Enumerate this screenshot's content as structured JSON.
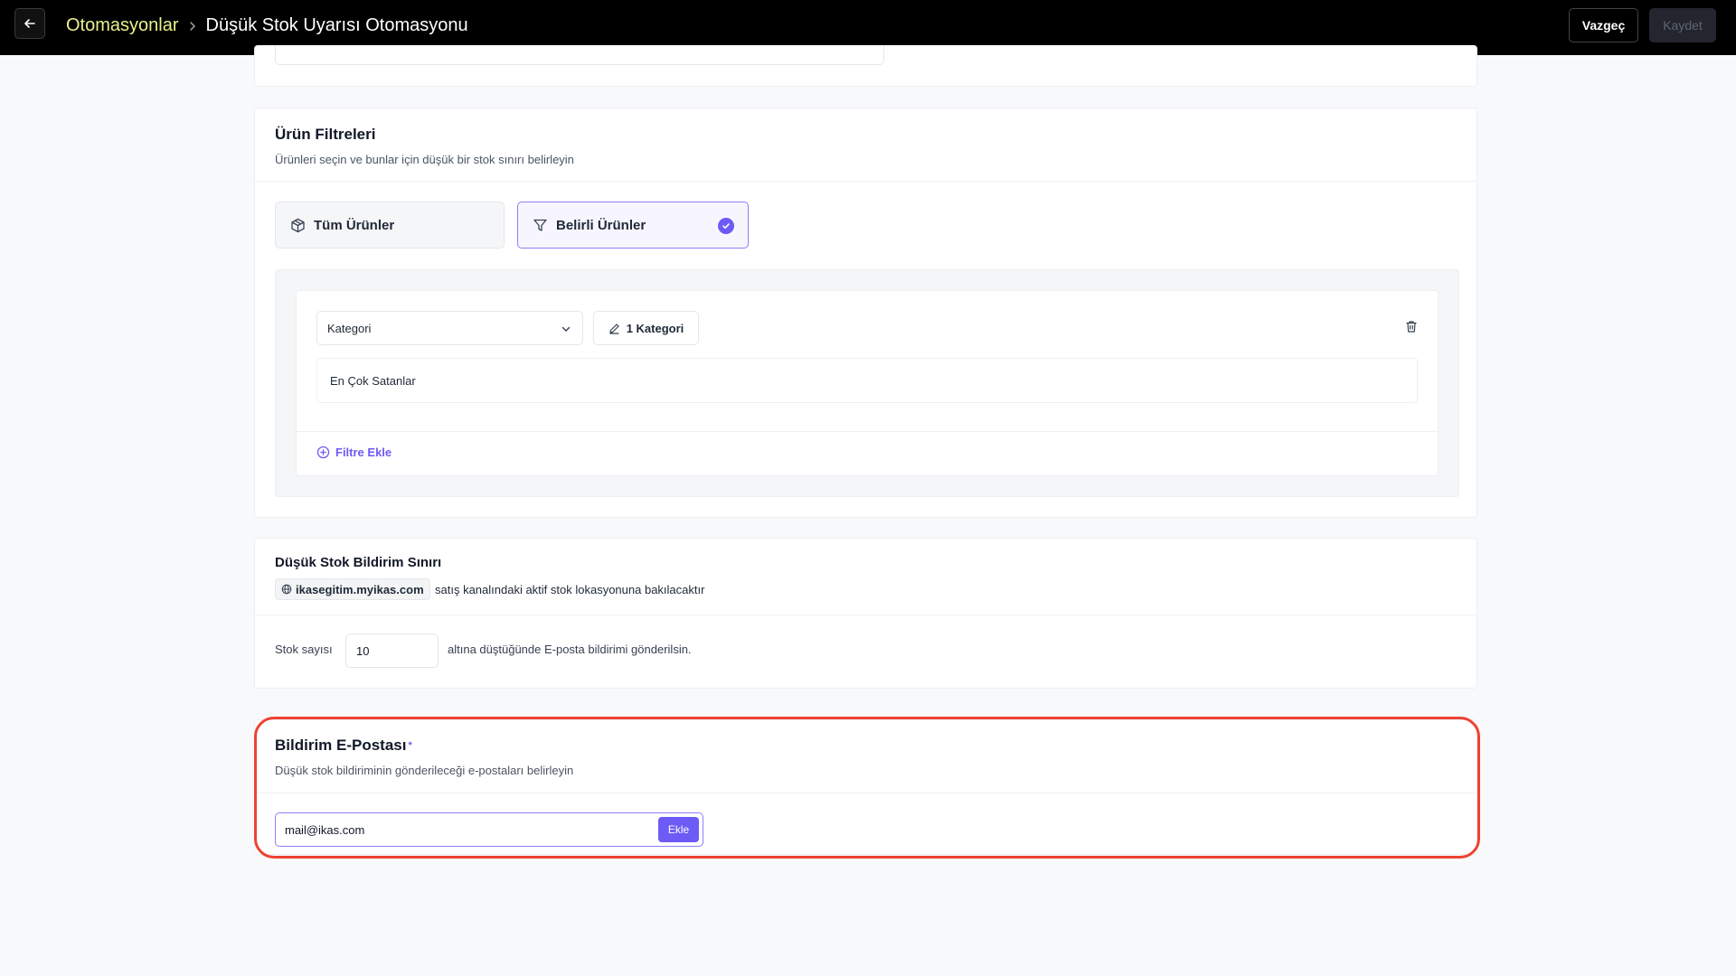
{
  "header": {
    "breadcrumb_parent": "Otomasyonlar",
    "title": "Düşük Stok Uyarısı Otomasyonu",
    "cancel_label": "Vazgeç",
    "save_label": "Kaydet"
  },
  "product_filters": {
    "title": "Ürün Filtreleri",
    "subtitle": "Ürünleri seçin ve bunlar için düşük bir stok sınırı belirleyin",
    "options": [
      {
        "label": "Tüm Ürünler",
        "selected": false
      },
      {
        "label": "Belirli Ürünler",
        "selected": true
      }
    ],
    "filter": {
      "type_value": "Kategori",
      "edit_label": "1 Kategori",
      "selected_value": "En Çok Satanlar"
    },
    "add_filter_label": "Filtre Ekle"
  },
  "stock_limit": {
    "title": "Düşük Stok Bildirim Sınırı",
    "channel": "ikasegitim.myikas.com",
    "channel_text": "satış kanalındaki aktif stok lokasyonuna bakılacaktır",
    "stock_label": "Stok sayısı",
    "stock_value": "10",
    "stock_suffix": "altına düştüğünde E-posta bildirimi gönderilsin."
  },
  "notification_email": {
    "title": "Bildirim E-Postası",
    "required_mark": "*",
    "subtitle": "Düşük stok bildiriminin gönderileceği e-postaları belirleyin",
    "email_value": "mail@ikas.com",
    "add_label": "Ekle"
  },
  "colors": {
    "accent": "#6d5bf6",
    "highlight": "#ee4233",
    "breadcrumb_link": "#e8f28a"
  }
}
